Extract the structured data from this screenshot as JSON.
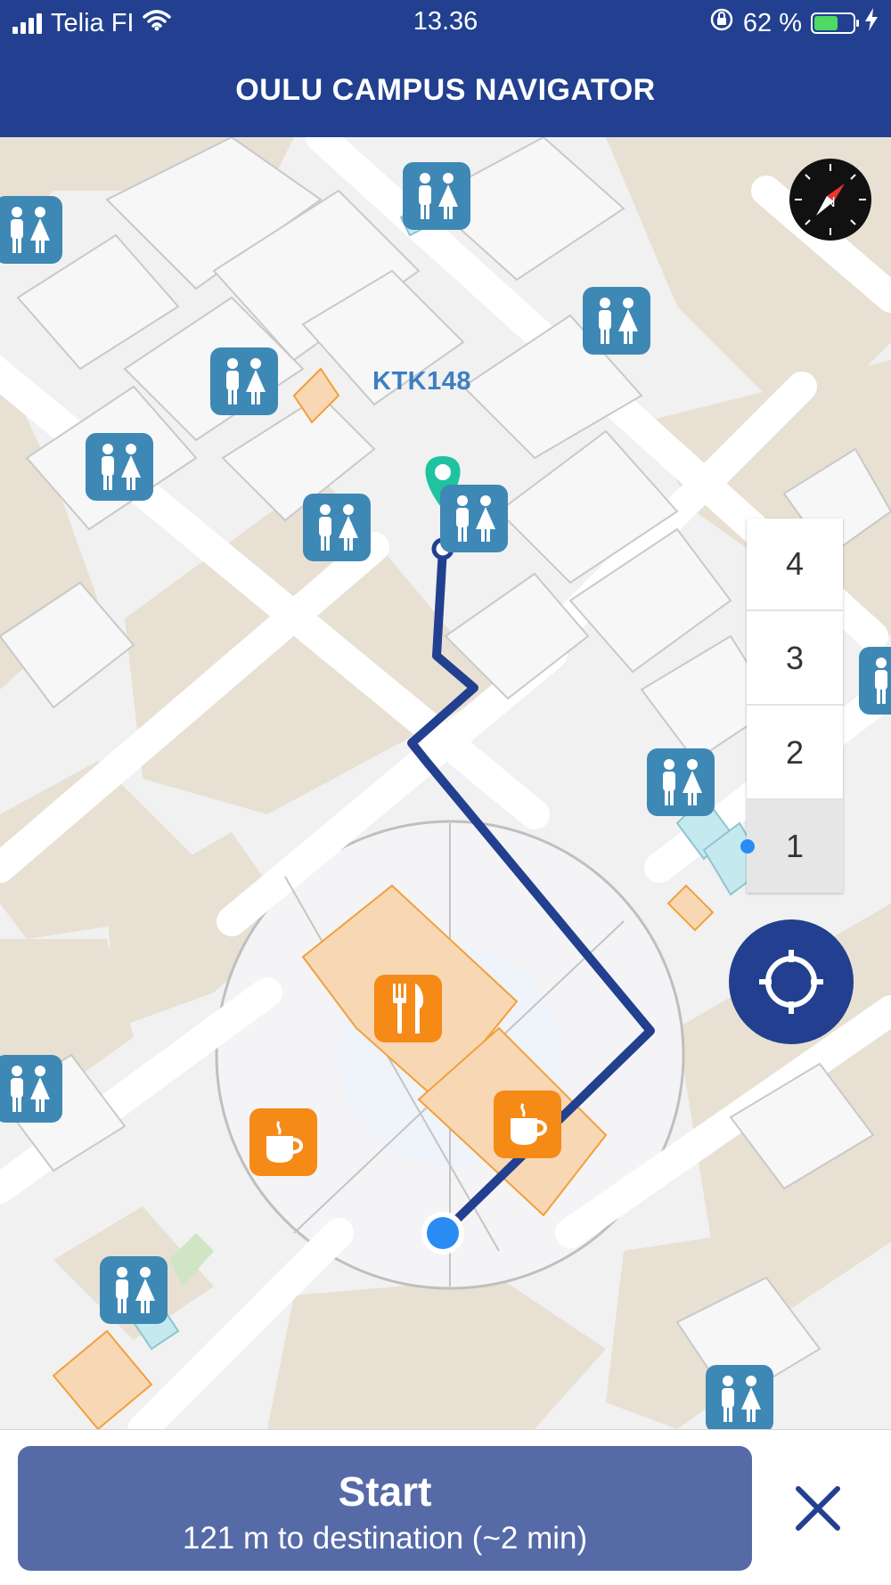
{
  "status_bar": {
    "carrier": "Telia FI",
    "time": "13.36",
    "battery_percent": "62 %",
    "battery_level": 0.62,
    "icons": [
      "cellular-signal-icon",
      "wifi-icon",
      "orientation-lock-icon",
      "battery-icon",
      "charging-bolt-icon"
    ]
  },
  "header": {
    "title": "OULU CAMPUS NAVIGATOR"
  },
  "map": {
    "destination_label": "KTK148",
    "pois": [
      "restroom-icon",
      "restaurant-icon",
      "cafe-icon"
    ],
    "colors": {
      "route": "#22408f",
      "destination_pin": "#1fc3a0",
      "current_location": "#2a8cf3",
      "restroom_poi": "#3e88b6",
      "food_poi": "#f58a16",
      "building": "#e8e0d2",
      "corridor": "#ffffff"
    }
  },
  "floor_selector": {
    "floors": [
      "4",
      "3",
      "2",
      "1"
    ],
    "selected": "1"
  },
  "controls": {
    "compass_icon": "compass-icon",
    "locate_icon": "crosshair-icon"
  },
  "bottom_bar": {
    "start_label": "Start",
    "route_info": "121 m to destination (~2 min)",
    "close_icon": "close-icon"
  }
}
